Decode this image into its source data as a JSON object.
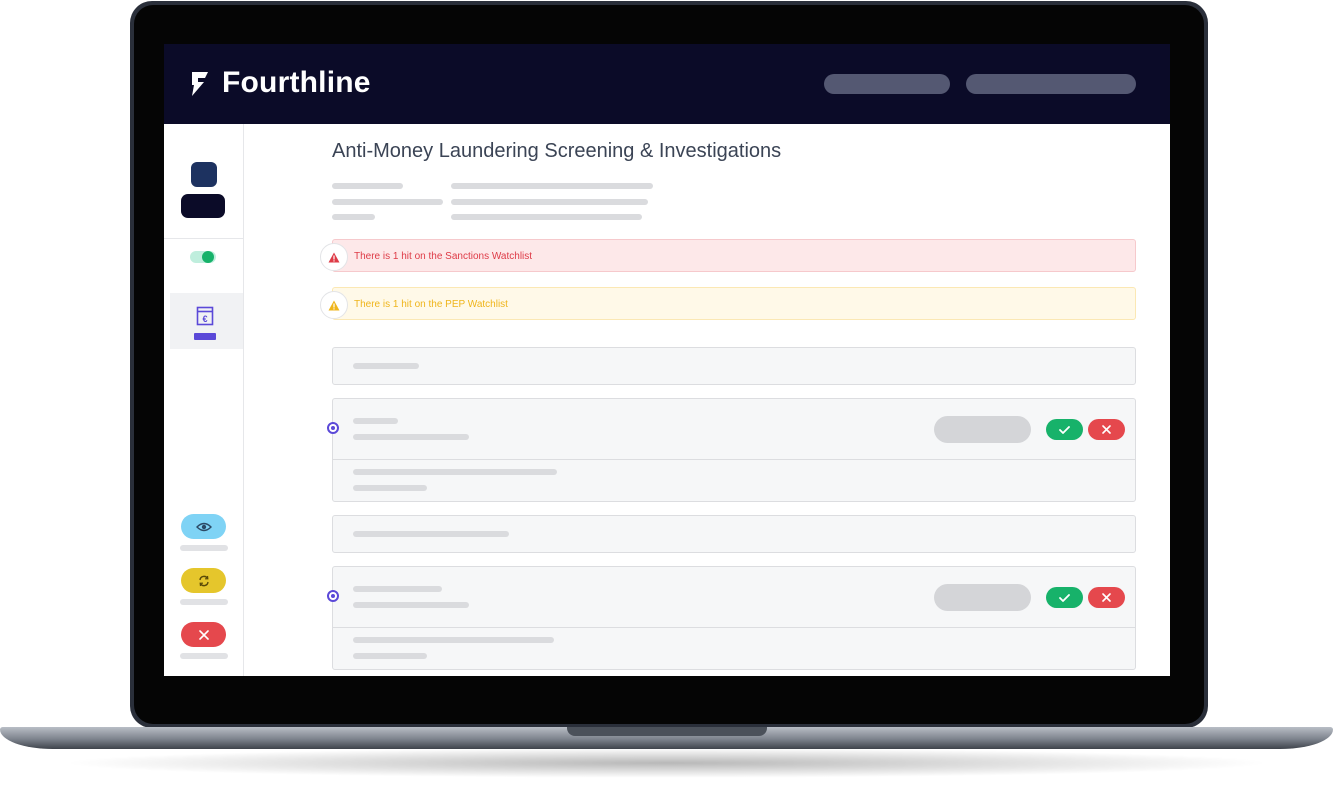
{
  "app": {
    "brand": "Fourthline"
  },
  "page": {
    "title": "Anti-Money Laundering Screening & Investigations"
  },
  "alerts": [
    {
      "type": "error",
      "icon": "warning-triangle-icon",
      "color": "#de3b47",
      "text": "There is 1 hit on the Sanctions Watchlist"
    },
    {
      "type": "warning",
      "icon": "warning-triangle-icon",
      "color": "#efb51c",
      "text": "There is 1 hit on the PEP Watchlist"
    }
  ],
  "sidebar": {
    "toggle_on": true,
    "active_nav_icon": "euro-document-icon",
    "status_buttons": [
      {
        "icon": "eye-icon",
        "color": "#7fd3f5"
      },
      {
        "icon": "refresh-icon",
        "color": "#e5c62c"
      },
      {
        "icon": "close-icon",
        "color": "#e5484d"
      }
    ]
  },
  "colors": {
    "topbar": "#0b0b28",
    "accent": "#5b49d8",
    "approve": "#17b26a",
    "reject": "#e5484d"
  }
}
